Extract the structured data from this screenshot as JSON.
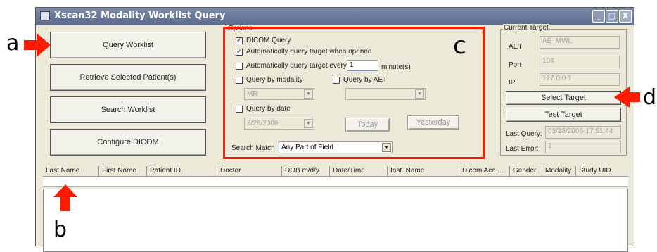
{
  "window": {
    "title": "Xscan32 Modality Worklist Query",
    "min": "_",
    "max": "□",
    "close": "X"
  },
  "actions": {
    "query": "Query Worklist",
    "retrieve": "Retrieve Selected Patient(s)",
    "search": "Search Worklist",
    "configure": "Configure DICOM"
  },
  "options": {
    "group_label": "Options",
    "dicom_query": "DICOM Query",
    "auto_query": "Automatically query target when opened",
    "auto_query_every": "Automatically query target every",
    "interval_value": "1",
    "interval_unit": "minute(s)",
    "by_modality": "Query by modality",
    "modality_value": "MR",
    "by_aet": "Query by AET",
    "aet_value": "",
    "by_date": "Query by date",
    "date_value": "3/28/2006",
    "today": "Today",
    "yesterday": "Yesterday",
    "search_match_label": "Search Match",
    "search_match_value": "Any Part of Field",
    "check_mark": "✓"
  },
  "target": {
    "group_label": "Current Target",
    "aet_label": "AET",
    "aet_value": "AE_MWL",
    "port_label": "Port",
    "port_value": "104",
    "ip_label": "IP",
    "ip_value": "127.0.0.1",
    "select": "Select Target",
    "test": "Test Target",
    "last_query_label": "Last Query:",
    "last_query_value": "03/28/2006-17:51:44",
    "last_error_label": "Last Error:",
    "last_error_value": "1"
  },
  "columns": [
    "Last Name",
    "First Name",
    "Patient ID",
    "Doctor",
    "DOB m/d/y",
    "Date/Time",
    "Inst. Name",
    "Dicom Acc ...",
    "Gender",
    "Modality",
    "Study UID"
  ],
  "annotations": {
    "a": "a",
    "b": "b",
    "c": "c",
    "d": "d"
  },
  "colors": {
    "annotation_arrow": "#ff1a00",
    "annotation_box": "#ff1a00",
    "title_bar": "#6a7898"
  }
}
